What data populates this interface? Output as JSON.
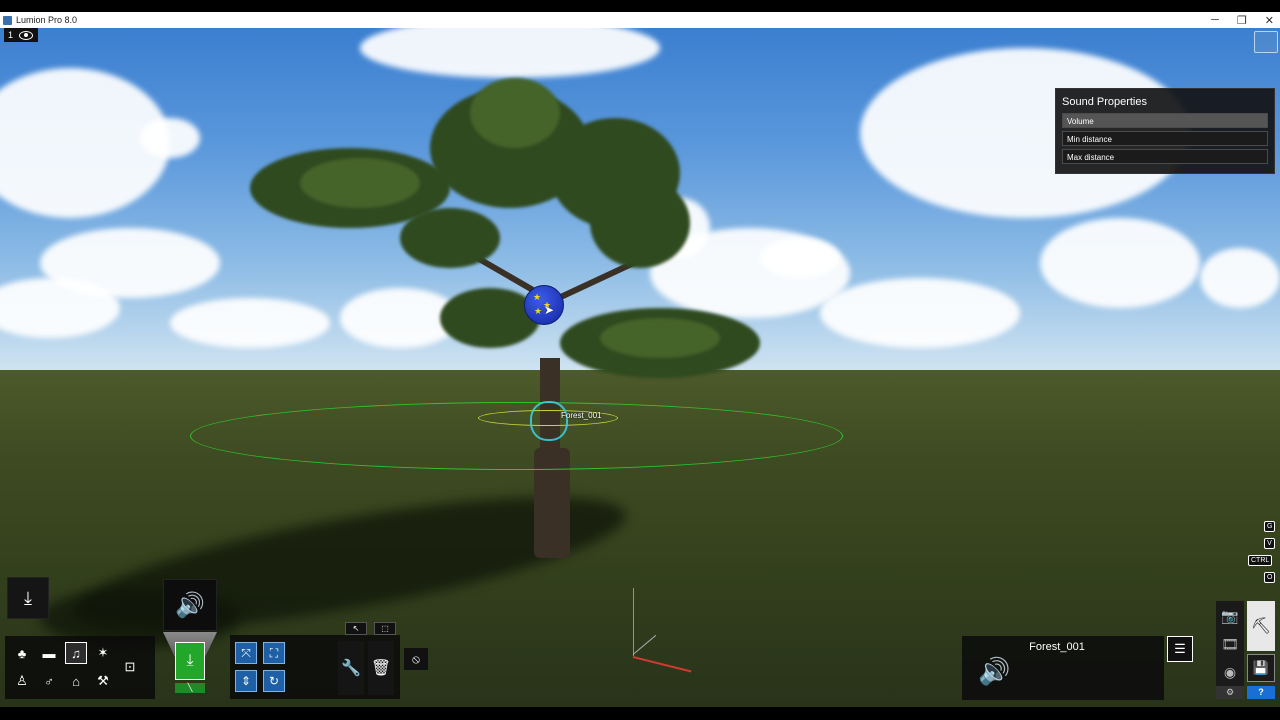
{
  "window": {
    "title": "Lumion Pro 8.0",
    "minimize_glyph": "─",
    "restore_glyph": "❐",
    "close_glyph": "✕"
  },
  "viewport": {
    "camera_slot": "1",
    "selected_object_label": "Forest_001"
  },
  "sound_properties": {
    "title": "Sound Properties",
    "rows": [
      "Volume",
      "Min distance",
      "Max distance"
    ]
  },
  "key_hints": [
    "G",
    "V",
    "CTRL",
    "O"
  ],
  "object_panel": {
    "name": "Forest_001"
  },
  "icons": {
    "place": "download-icon",
    "sound": "speaker-icon",
    "insert": "download-icon",
    "tool": "wrench-icon",
    "delete": "trash-icon",
    "cancel": "prohibit-icon",
    "settings": "sliders-icon",
    "photo": "camera-icon",
    "movie": "film-icon",
    "panorama": "globe-icon",
    "build": "builder-icon",
    "save": "floppy-icon",
    "help": "?"
  },
  "colors": {
    "accent_green": "#23a72a",
    "accent_blue": "#1f5fa6",
    "ring_green": "#31c22e",
    "emitter_cyan": "#39d5e8"
  }
}
